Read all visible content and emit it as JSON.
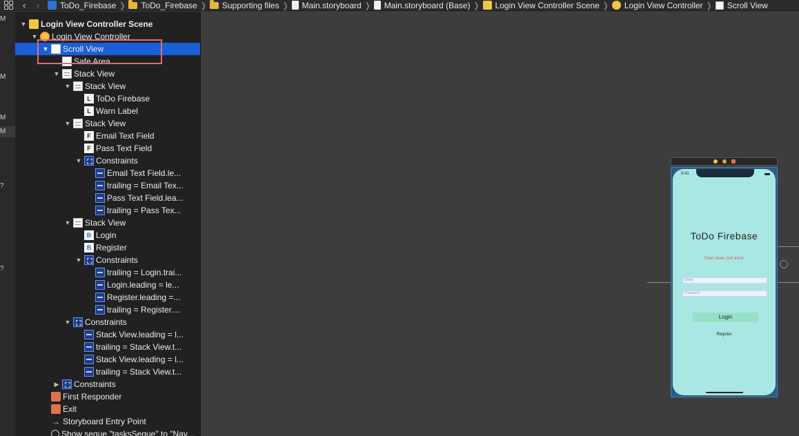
{
  "breadcrumbs": [
    {
      "label": "ToDo_Firebase",
      "icon": "xcode-project-icon"
    },
    {
      "label": "ToDo_Firebase",
      "icon": "folder-icon"
    },
    {
      "label": "Supporting files",
      "icon": "folder-icon"
    },
    {
      "label": "Main.storyboard",
      "icon": "storyboard-file-icon"
    },
    {
      "label": "Main.storyboard (Base)",
      "icon": "storyboard-file-icon"
    },
    {
      "label": "Login View Controller Scene",
      "icon": "scene-icon"
    },
    {
      "label": "Login View Controller",
      "icon": "view-controller-icon"
    },
    {
      "label": "Scroll View",
      "icon": "scroll-view-icon"
    }
  ],
  "edge_strip": {
    "m": "M",
    "q": "?"
  },
  "outline": [
    {
      "label": "Login View Controller Scene",
      "icon": "scene-icon",
      "tri": "▼",
      "indent": 0,
      "bold": true
    },
    {
      "label": "Login View Controller",
      "icon": "view-controller-icon",
      "tri": "▼",
      "indent": 1
    },
    {
      "label": "Scroll View",
      "icon": "scroll-view-icon",
      "tri": "▼",
      "indent": 2,
      "selected": true
    },
    {
      "label": "Safe Area",
      "icon": "safe-area-icon",
      "tri": "",
      "indent": 3
    },
    {
      "label": "Stack View",
      "icon": "stack-view-icon",
      "tri": "▼",
      "indent": 3
    },
    {
      "label": "Stack View",
      "icon": "stack-view-icon",
      "tri": "▼",
      "indent": 4
    },
    {
      "label": "ToDo Firebase",
      "icon": "label-icon",
      "tri": "",
      "indent": 5
    },
    {
      "label": "Warn Label",
      "icon": "label-icon",
      "tri": "",
      "indent": 5
    },
    {
      "label": "Stack View",
      "icon": "stack-view-icon",
      "tri": "▼",
      "indent": 4
    },
    {
      "label": "Email Text Field",
      "icon": "text-field-icon",
      "tri": "",
      "indent": 5
    },
    {
      "label": "Pass Text Field",
      "icon": "text-field-icon",
      "tri": "",
      "indent": 5
    },
    {
      "label": "Constraints",
      "icon": "constraints-icon",
      "tri": "▼",
      "indent": 5
    },
    {
      "label": "Email Text Field.le...",
      "icon": "constraint-icon",
      "tri": "",
      "indent": 6
    },
    {
      "label": "trailing = Email Tex...",
      "icon": "constraint-icon",
      "tri": "",
      "indent": 6
    },
    {
      "label": "Pass Text Field.lea...",
      "icon": "constraint-icon",
      "tri": "",
      "indent": 6
    },
    {
      "label": "trailing = Pass Tex...",
      "icon": "constraint-icon",
      "tri": "",
      "indent": 6
    },
    {
      "label": "Stack View",
      "icon": "stack-view-icon",
      "tri": "▼",
      "indent": 4
    },
    {
      "label": "Login",
      "icon": "button-icon",
      "tri": "",
      "indent": 5
    },
    {
      "label": "Register",
      "icon": "button-icon",
      "tri": "",
      "indent": 5
    },
    {
      "label": "Constraints",
      "icon": "constraints-icon",
      "tri": "▼",
      "indent": 5
    },
    {
      "label": "trailing = Login.trai...",
      "icon": "constraint-icon",
      "tri": "",
      "indent": 6
    },
    {
      "label": "Login.leading = le...",
      "icon": "constraint-icon",
      "tri": "",
      "indent": 6
    },
    {
      "label": "Register.leading =...",
      "icon": "constraint-icon",
      "tri": "",
      "indent": 6
    },
    {
      "label": "trailing = Register....",
      "icon": "constraint-icon",
      "tri": "",
      "indent": 6
    },
    {
      "label": "Constraints",
      "icon": "constraints-icon",
      "tri": "▼",
      "indent": 4
    },
    {
      "label": "Stack View.leading = l...",
      "icon": "constraint-icon",
      "tri": "",
      "indent": 5
    },
    {
      "label": "trailing = Stack View.t...",
      "icon": "constraint-icon",
      "tri": "",
      "indent": 5
    },
    {
      "label": "Stack View.leading = l...",
      "icon": "constraint-icon",
      "tri": "",
      "indent": 5
    },
    {
      "label": "trailing = Stack View.t...",
      "icon": "constraint-icon",
      "tri": "",
      "indent": 5
    },
    {
      "label": "Constraints",
      "icon": "constraints-icon",
      "tri": "▶",
      "indent": 3
    },
    {
      "label": "First Responder",
      "icon": "first-responder-icon",
      "tri": "",
      "indent": 2
    },
    {
      "label": "Exit",
      "icon": "exit-icon",
      "tri": "",
      "indent": 2
    },
    {
      "label": "Storyboard Entry Point",
      "icon": "entry-point-arrow-icon",
      "tri": "",
      "indent": 2
    },
    {
      "label": "Show segue \"tasksSegue\" to \"Nav...",
      "icon": "segue-icon",
      "tri": "",
      "indent": 2
    }
  ],
  "preview": {
    "time": "9:41",
    "title": "ToDo Firebase",
    "warning": "User does not exist",
    "email_placeholder": "Email",
    "password_placeholder": "Password",
    "login_label": "Login",
    "register_label": "Register"
  },
  "colors": {
    "selection": "#1a5fd8",
    "screen_background": "#a9e7e4",
    "warning_text": "#d84a4a",
    "highlight_box": "#e06b7a"
  }
}
